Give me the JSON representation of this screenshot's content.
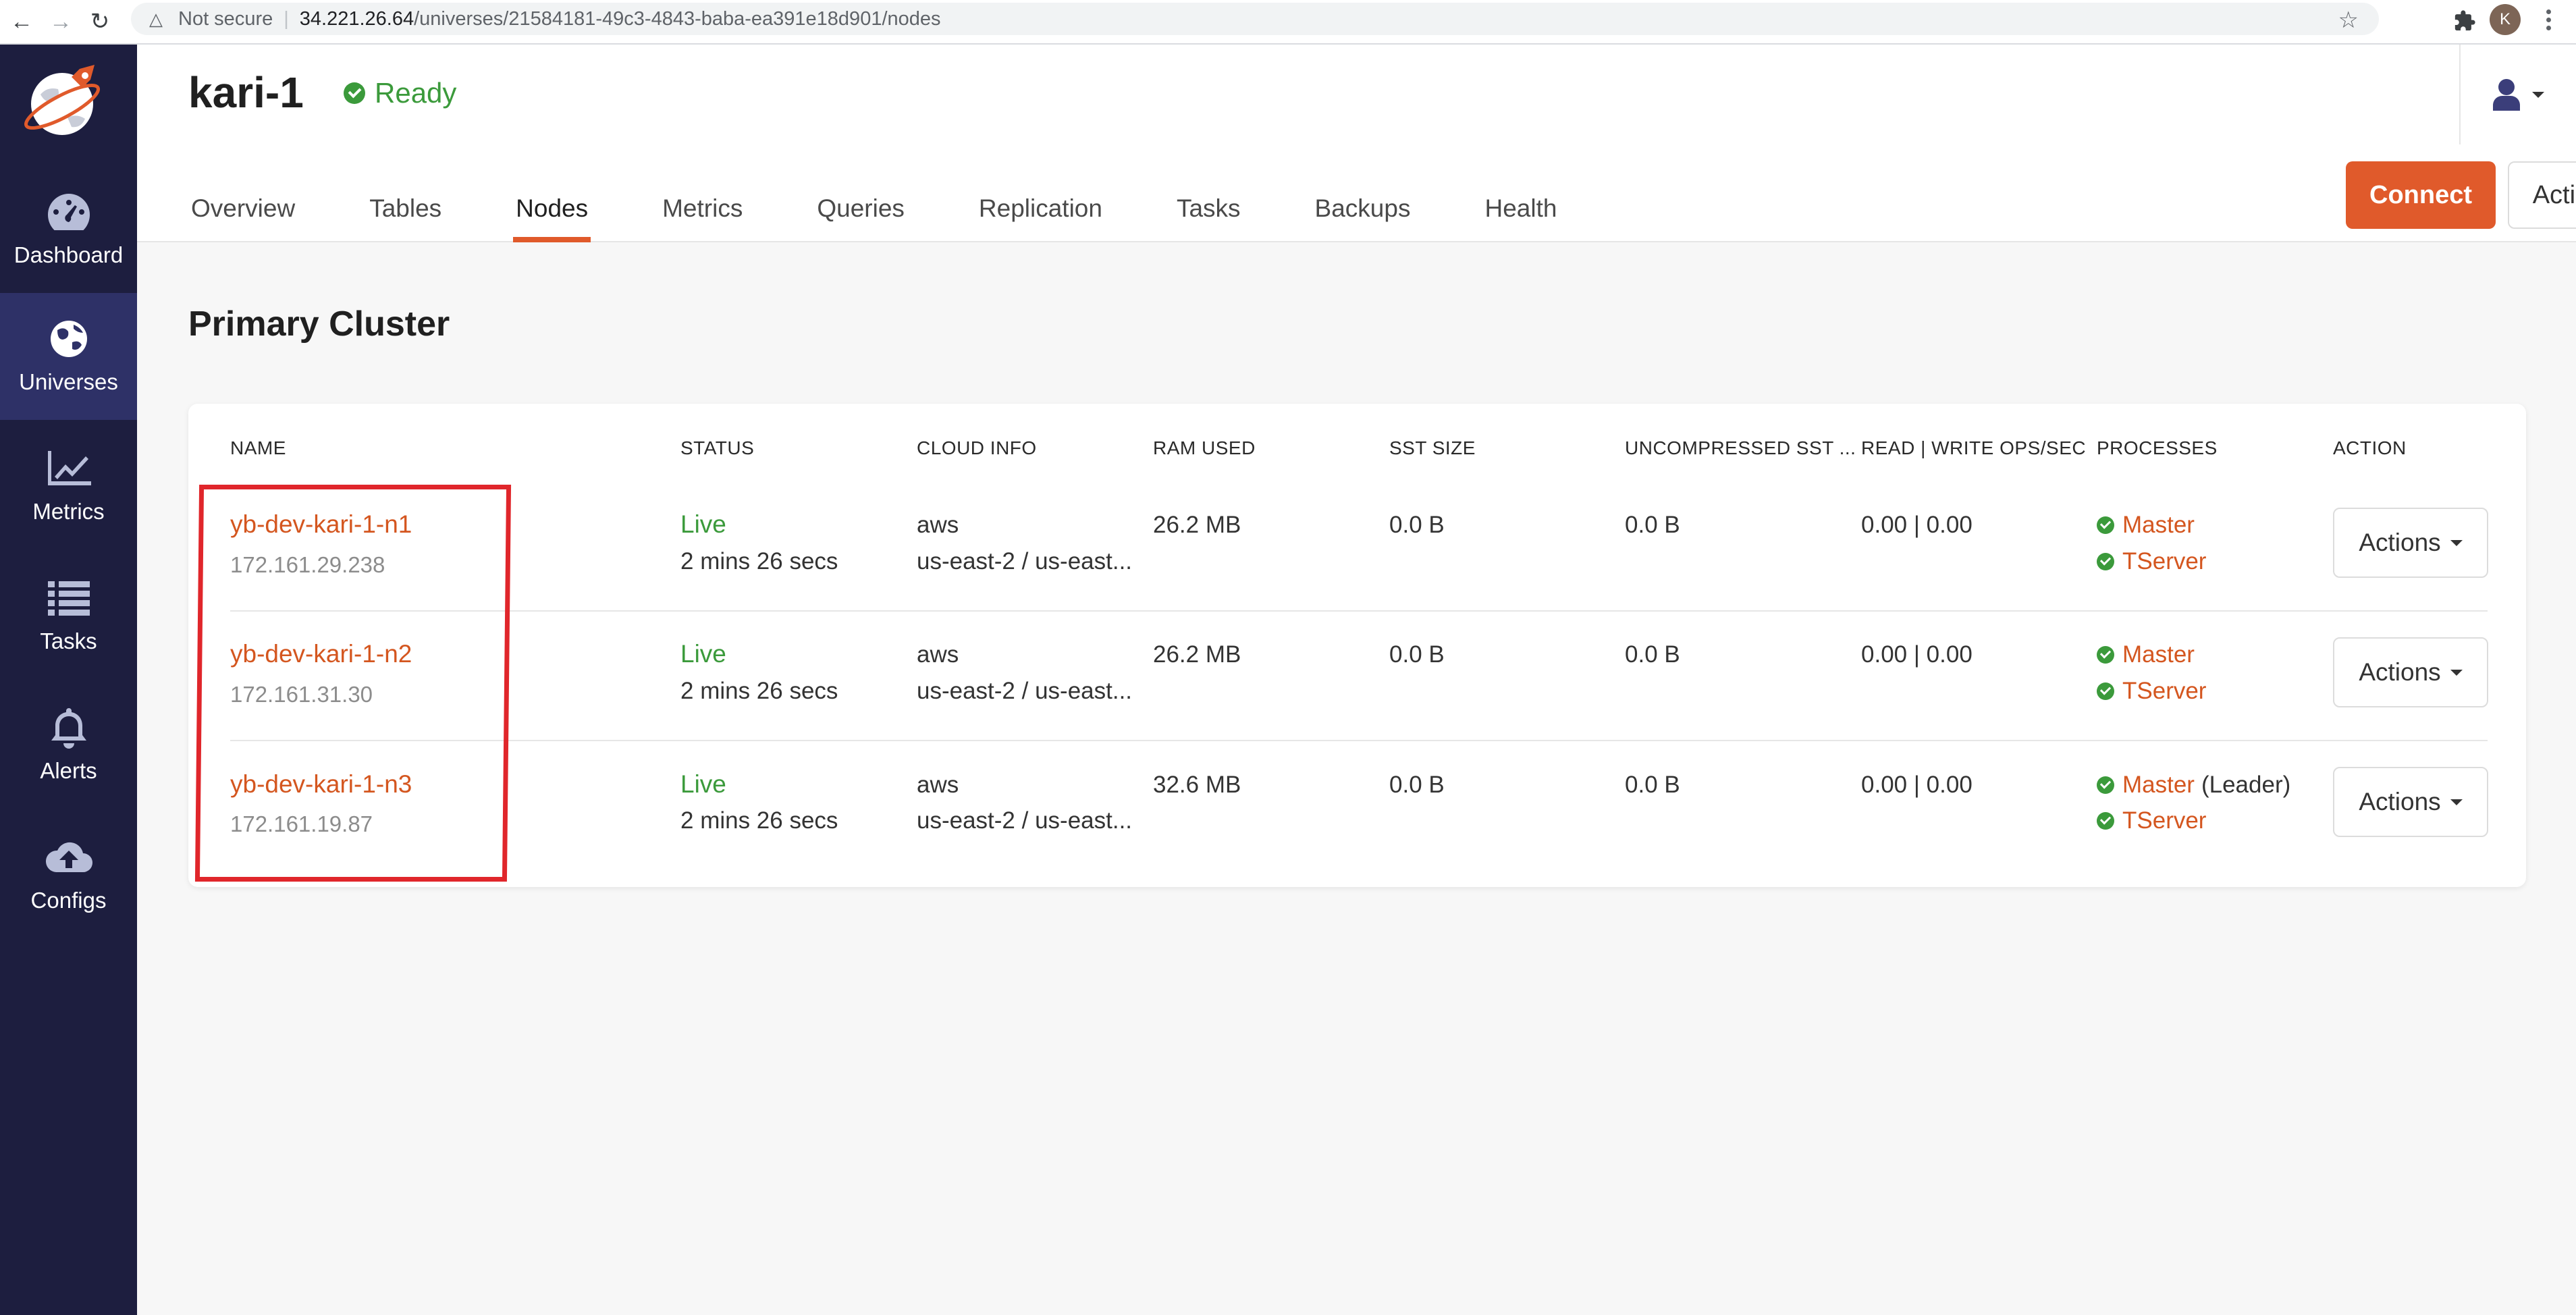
{
  "browser": {
    "not_secure": "Not secure",
    "host": "34.221.26.64",
    "path": "/universes/21584181-49c3-4843-baba-ea391e18d901/nodes",
    "profile_initial": "K"
  },
  "sidebar": {
    "items": [
      {
        "label": "Dashboard",
        "icon": "dashboard-icon"
      },
      {
        "label": "Universes",
        "icon": "globe-icon"
      },
      {
        "label": "Metrics",
        "icon": "chart-line-icon"
      },
      {
        "label": "Tasks",
        "icon": "list-icon"
      },
      {
        "label": "Alerts",
        "icon": "bell-icon"
      },
      {
        "label": "Configs",
        "icon": "cloud-upload-icon"
      }
    ],
    "active": "Universes"
  },
  "header": {
    "title": "kari-1",
    "status": "Ready",
    "tabs": [
      "Overview",
      "Tables",
      "Nodes",
      "Metrics",
      "Queries",
      "Replication",
      "Tasks",
      "Backups",
      "Health"
    ],
    "active_tab": "Nodes",
    "connect_label": "Connect",
    "actions_label": "Actions"
  },
  "section": {
    "title": "Primary Cluster"
  },
  "table": {
    "columns": [
      "NAME",
      "STATUS",
      "CLOUD INFO",
      "RAM USED",
      "SST SIZE",
      "UNCOMPRESSED SST ...",
      "READ | WRITE OPS/SEC",
      "PROCESSES",
      "ACTION"
    ],
    "rows": [
      {
        "name": "yb-dev-kari-1-n1",
        "ip": "172.161.29.238",
        "status": "Live",
        "uptime": "2 mins 26 secs",
        "cloud": "aws",
        "region": "us-east-2 / us-east...",
        "ram": "26.2 MB",
        "sst": "0.0 B",
        "uncompressed": "0.0 B",
        "ops": "0.00 | 0.00",
        "master": "Master",
        "master_note": "",
        "tserver": "TServer",
        "action": "Actions"
      },
      {
        "name": "yb-dev-kari-1-n2",
        "ip": "172.161.31.30",
        "status": "Live",
        "uptime": "2 mins 26 secs",
        "cloud": "aws",
        "region": "us-east-2 / us-east...",
        "ram": "26.2 MB",
        "sst": "0.0 B",
        "uncompressed": "0.0 B",
        "ops": "0.00 | 0.00",
        "master": "Master",
        "master_note": "",
        "tserver": "TServer",
        "action": "Actions"
      },
      {
        "name": "yb-dev-kari-1-n3",
        "ip": "172.161.19.87",
        "status": "Live",
        "uptime": "2 mins 26 secs",
        "cloud": "aws",
        "region": "us-east-2 / us-east...",
        "ram": "32.6 MB",
        "sst": "0.0 B",
        "uncompressed": "0.0 B",
        "ops": "0.00 | 0.00",
        "master": "Master",
        "master_note": "(Leader)",
        "tserver": "TServer",
        "action": "Actions"
      }
    ]
  },
  "colors": {
    "accent": "#e05a2b",
    "sidebar_bg": "#1d1e3f",
    "sidebar_active": "#2e3167",
    "success": "#3b9a3b",
    "annotation": "#e0262b"
  }
}
